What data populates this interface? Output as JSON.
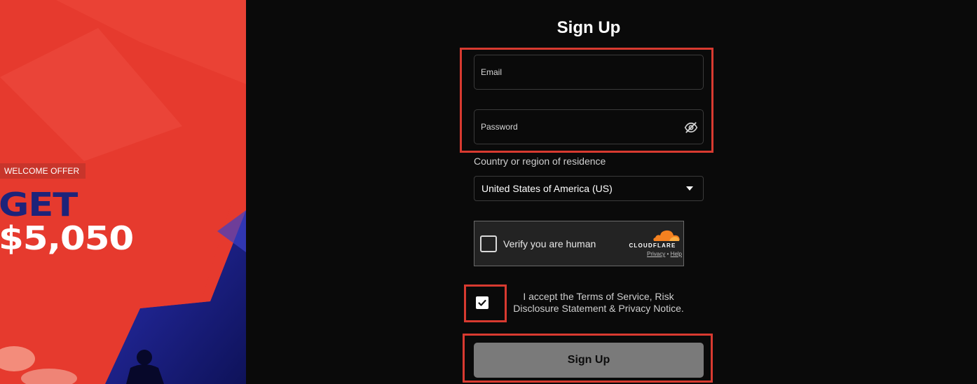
{
  "promo": {
    "badge": "WELCOME OFFER",
    "headline_line1": "GET",
    "headline_line2": "$5,050"
  },
  "form": {
    "title": "Sign Up",
    "email": {
      "placeholder": "Email",
      "value": ""
    },
    "password": {
      "placeholder": "Password",
      "value": "",
      "toggle_icon": "eye-slash-icon"
    },
    "country_label": "Country or region of residence",
    "country_value": "United States of America (US)",
    "captcha": {
      "label": "Verify you are human",
      "brand": "CLOUDFLARE",
      "privacy": "Privacy",
      "separator": "•",
      "help": "Help"
    },
    "terms": {
      "checked": true,
      "text": "I accept the Terms of Service, Risk Disclosure Statement & Privacy Notice."
    },
    "submit_label": "Sign Up"
  },
  "colors": {
    "promo_red": "#e63a2e",
    "promo_navy": "#1d237a",
    "highlight": "#d83a30",
    "button_gray": "#7a7a7a",
    "cloudflare_orange": "#f48120"
  }
}
